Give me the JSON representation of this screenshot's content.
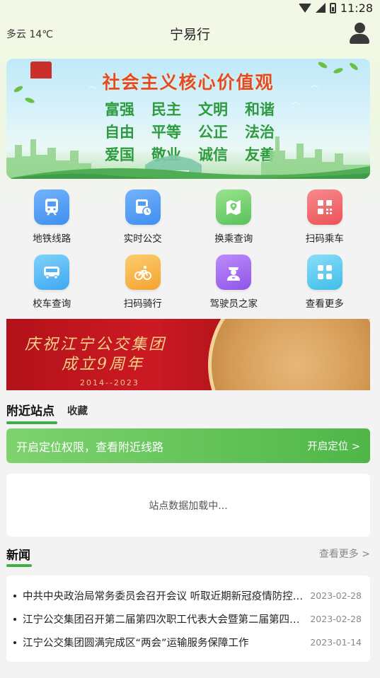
{
  "status_bar": {
    "time": "11:28"
  },
  "header": {
    "weather": "多云 14℃",
    "title": "宁易行"
  },
  "banner": {
    "title": "社会主义核心价值观",
    "values": [
      "富强",
      "民主",
      "文明",
      "和谐",
      "自由",
      "平等",
      "公正",
      "法治",
      "爱国",
      "敬业",
      "诚信",
      "友善"
    ]
  },
  "grid": {
    "items": [
      {
        "label": "地铁线路",
        "icon": "subway-icon",
        "color": "#4f9cf5"
      },
      {
        "label": "实时公交",
        "icon": "bus-clock-icon",
        "color": "#4f9cf5"
      },
      {
        "label": "换乘查询",
        "icon": "map-pin-icon",
        "color": "#6fd06c"
      },
      {
        "label": "扫码乘车",
        "icon": "qr-code-icon",
        "color": "#f0676c"
      },
      {
        "label": "校车查询",
        "icon": "school-bus-icon",
        "color": "#4fb4f5"
      },
      {
        "label": "扫码骑行",
        "icon": "bicycle-icon",
        "color": "#f7b54a"
      },
      {
        "label": "驾驶员之家",
        "icon": "driver-icon",
        "color": "#a46bf2"
      },
      {
        "label": "查看更多",
        "icon": "grid-more-icon",
        "color": "#56c8ef"
      }
    ]
  },
  "anniversary": {
    "line1": "庆祝江宁公交集团",
    "line2": "成立9周年",
    "years": "2014--2023"
  },
  "tabs": {
    "nearby": "附近站点",
    "favorites": "收藏"
  },
  "location": {
    "text": "开启定位权限，查看附近线路",
    "button": "开启定位 >"
  },
  "stations": {
    "loading": "站点数据加载中..."
  },
  "news": {
    "title": "新闻",
    "more": "查看更多 >",
    "items": [
      {
        "title": "中共中央政治局常务委员会召开会议 听取近期新冠疫情防控工作情况汇报",
        "date": "2023-02-28"
      },
      {
        "title": "江宁公交集团召开第二届第四次职工代表大会暨第二届第四次工会会员代表大会",
        "date": "2023-02-28"
      },
      {
        "title": "江宁公交集团圆满完成区“两会”运输服务保障工作",
        "date": "2023-01-14"
      }
    ]
  }
}
